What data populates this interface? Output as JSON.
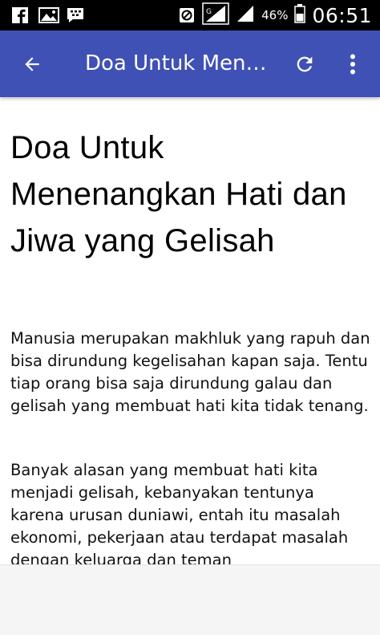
{
  "status_bar": {
    "battery_percent": "46%",
    "time": "06:51",
    "icons": [
      "facebook-icon",
      "gallery-icon",
      "bbm-icon",
      "no-sim-icon",
      "signal-icon",
      "signal-icon",
      "battery-icon"
    ]
  },
  "toolbar": {
    "title": "Doa Untuk Menenangkan Hati dan Jiwa yang Gelisah",
    "color": "#3f51b5",
    "icons": [
      "arrow-back-icon",
      "refresh-icon",
      "more-vert-icon"
    ]
  },
  "article": {
    "title": "Doa Untuk Menenangkan Hati dan Jiwa yang Gelisah",
    "paragraphs": [
      "Manusia merupakan makhluk yang rapuh dan bisa dirundung kegelisahan kapan saja. Tentu tiap orang bisa saja dirundung galau dan gelisah yang membuat hati kita tidak tenang.",
      "Banyak alasan yang membuat hati kita menjadi gelisah, kebanyakan tentunya karena urusan duniawi, entah itu masalah ekonomi, pekerjaan atau terdapat masalah dengan keluarga dan teman"
    ]
  }
}
